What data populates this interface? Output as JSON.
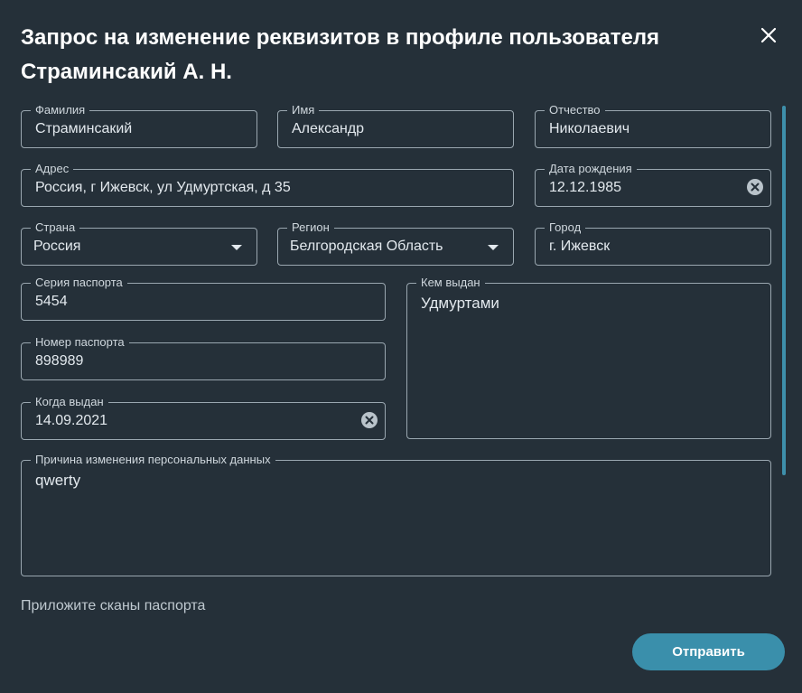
{
  "dialog": {
    "title": "Запрос на изменение реквизитов в профиле пользователя Страминсакий А. Н."
  },
  "form": {
    "surname": {
      "label": "Фамилия",
      "value": "Страминсакий"
    },
    "name": {
      "label": "Имя",
      "value": "Александр"
    },
    "patronymic": {
      "label": "Отчество",
      "value": "Николаевич"
    },
    "address": {
      "label": "Адрес",
      "value": "Россия, г Ижевск, ул Удмуртская, д 35"
    },
    "birth_date": {
      "label": "Дата рождения",
      "value": "12.12.1985"
    },
    "country": {
      "label": "Страна",
      "value": "Россия"
    },
    "region": {
      "label": "Регион",
      "value": "Белгородская Область"
    },
    "city": {
      "label": "Город",
      "value": "г. Ижевск"
    },
    "passport_series": {
      "label": "Серия паспорта",
      "value": "5454"
    },
    "issued_by": {
      "label": "Кем выдан",
      "value": "Удмуртами"
    },
    "passport_number": {
      "label": "Номер паспорта",
      "value": "898989"
    },
    "issue_date": {
      "label": "Когда выдан",
      "value": "14.09.2021"
    },
    "reason": {
      "label": "Причина изменения персональных данных",
      "value": "qwerty"
    }
  },
  "attach_text": "Приложите сканы паспорта",
  "submit_label": "Отправить",
  "icons": {
    "close": "close-icon",
    "clear": "clear-icon",
    "dropdown": "chevron-down-icon"
  },
  "colors": {
    "background": "#253039",
    "accent": "#3a8fab",
    "border": "#9aa7b0"
  }
}
